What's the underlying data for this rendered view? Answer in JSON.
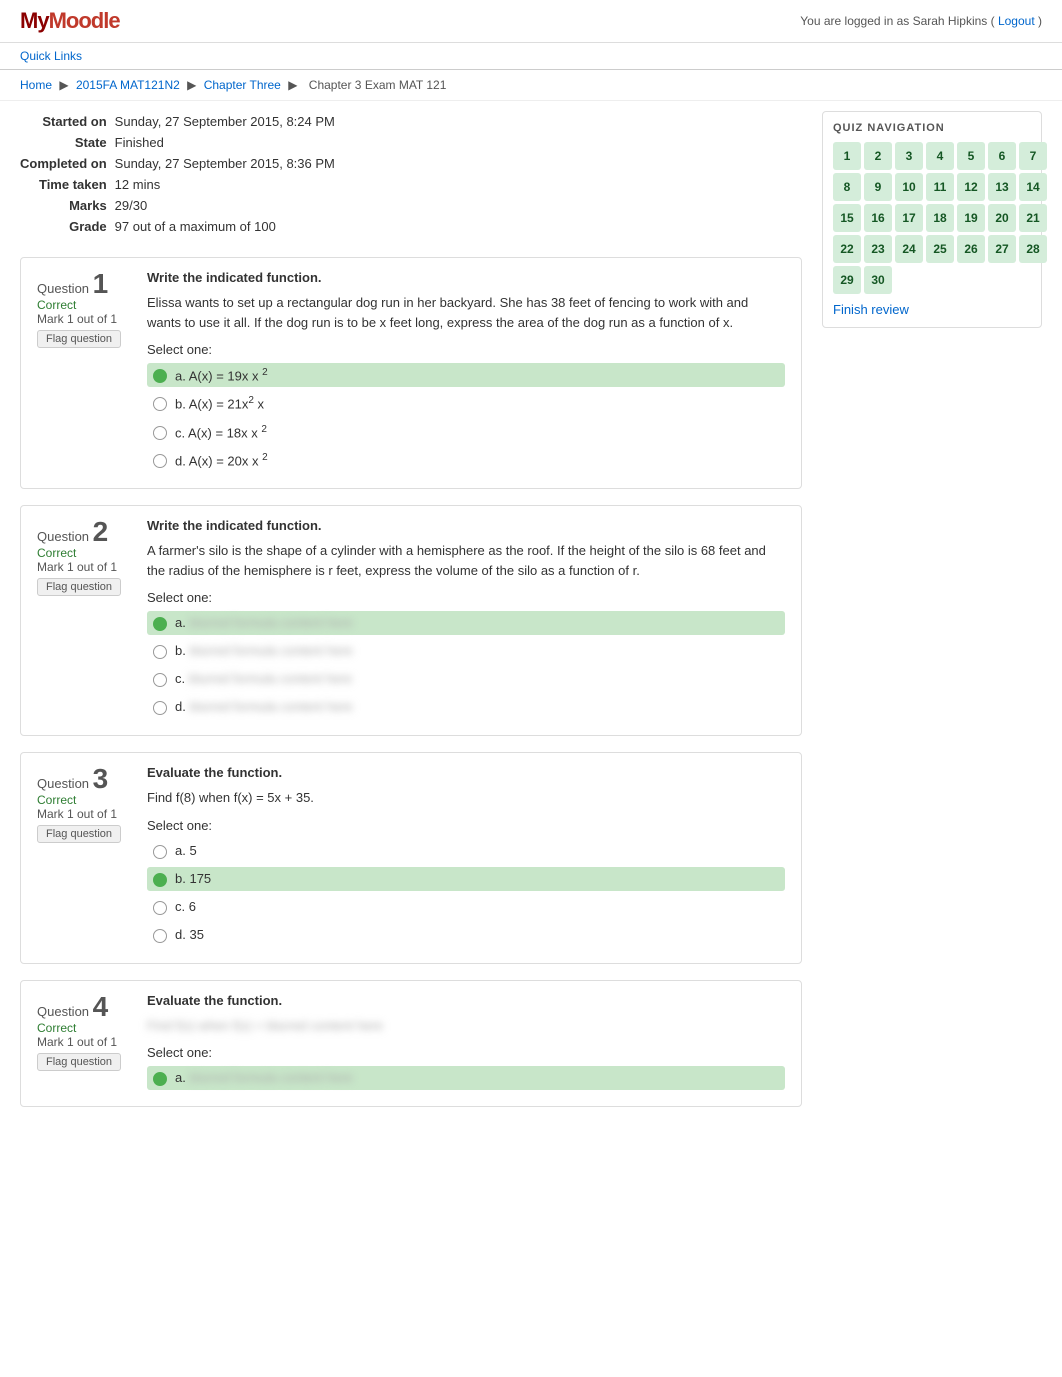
{
  "header": {
    "logo": "MyMoodle",
    "user_text": "You are logged in as Sarah Hipkins (",
    "logout_label": "Logout",
    "user_suffix": ")"
  },
  "quick_links": "Quick Links",
  "breadcrumb": {
    "home": "Home",
    "course": "2015FA MAT121N2",
    "chapter": "Chapter Three",
    "exam": "Chapter 3 Exam MAT 121"
  },
  "quiz_info": {
    "started_on_label": "Started on",
    "started_on_value": "Sunday, 27 September 2015, 8:24 PM",
    "state_label": "State",
    "state_value": "Finished",
    "completed_on_label": "Completed on",
    "completed_on_value": "Sunday, 27 September 2015, 8:36 PM",
    "time_taken_label": "Time taken",
    "time_taken_value": "12 mins",
    "marks_label": "Marks",
    "marks_value": "29/30",
    "grade_label": "Grade",
    "grade_value": "97 out of a maximum of 100"
  },
  "quiz_nav": {
    "title": "QUIZ NAVIGATION",
    "numbers": [
      1,
      2,
      3,
      4,
      5,
      6,
      7,
      8,
      9,
      10,
      11,
      12,
      13,
      14,
      15,
      16,
      17,
      18,
      19,
      20,
      21,
      22,
      23,
      24,
      25,
      26,
      27,
      28,
      29,
      30
    ],
    "finish_review": "Finish review"
  },
  "questions": [
    {
      "number": "1",
      "label": "Question",
      "status": "Correct",
      "mark": "Mark 1 out of 1",
      "flag": "Flag question",
      "text": "Write the indicated function.",
      "body": "Elissa wants to set up a rectangular dog run in her backyard. She has 38 feet of fencing to work with and wants to use it all. If the dog run is to be x feet long, express the area of the dog run as a function of x.",
      "select_one": "Select one:",
      "options": [
        {
          "label": "a.",
          "text": "A(x) = 19x  x ",
          "sup": "2",
          "correct": true
        },
        {
          "label": "b.",
          "text": "A(x) = 21x",
          "sup": "2",
          "suffix": " x",
          "correct": false
        },
        {
          "label": "c.",
          "text": "A(x) = 18x  x ",
          "sup": "2",
          "correct": false
        },
        {
          "label": "d.",
          "text": "A(x) = 20x  x ",
          "sup": "2",
          "correct": false
        }
      ]
    },
    {
      "number": "2",
      "label": "Question",
      "status": "Correct",
      "mark": "Mark 1 out of 1",
      "flag": "Flag question",
      "text": "Write the indicated function.",
      "body": "A farmer's silo is the shape of a cylinder with a hemisphere as the roof. If the height of the silo is 68 feet and the radius of the hemisphere is r feet, express the volume of the silo as a function of r.",
      "select_one": "Select one:",
      "options": [
        {
          "label": "a.",
          "blurred": true,
          "correct": true
        },
        {
          "label": "b.",
          "blurred": true,
          "correct": false
        },
        {
          "label": "c.",
          "blurred": true,
          "correct": false
        },
        {
          "label": "d.",
          "blurred": true,
          "correct": false
        }
      ]
    },
    {
      "number": "3",
      "label": "Question",
      "status": "Correct",
      "mark": "Mark 1 out of 1",
      "flag": "Flag question",
      "text": "Evaluate the function.",
      "body": "Find f(8) when f(x) = 5x + 35.",
      "select_one": "Select one:",
      "options": [
        {
          "label": "a.",
          "text": "5",
          "correct": false
        },
        {
          "label": "b.",
          "text": "175",
          "correct": true
        },
        {
          "label": "c.",
          "text": "6",
          "correct": false
        },
        {
          "label": "d.",
          "text": "35",
          "correct": false
        }
      ]
    },
    {
      "number": "4",
      "label": "Question",
      "status": "Correct",
      "mark": "Mark 1 out of 1",
      "flag": "Flag question",
      "text": "Evaluate the function.",
      "body_blurred": true,
      "select_one": "Select one:",
      "options": [
        {
          "label": "a.",
          "blurred": true,
          "correct": true
        }
      ]
    }
  ]
}
